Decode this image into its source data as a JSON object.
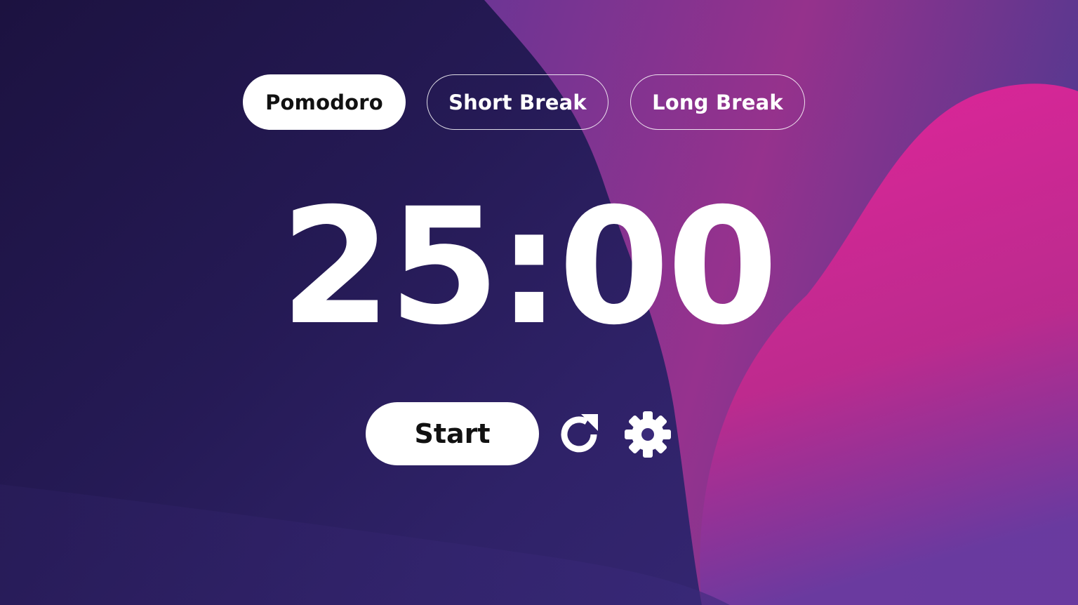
{
  "tabs": [
    {
      "label": "Pomodoro",
      "active": true
    },
    {
      "label": "Short Break",
      "active": false
    },
    {
      "label": "Long Break",
      "active": false
    }
  ],
  "timer": {
    "display": "25:00"
  },
  "controls": {
    "start_label": "Start",
    "reset_icon": "reset-icon",
    "settings_icon": "gear-icon"
  },
  "colors": {
    "background_dark": "#1c1240",
    "accent_pink": "#e0238f",
    "accent_purple": "#5a3a9e",
    "foreground": "#ffffff"
  }
}
